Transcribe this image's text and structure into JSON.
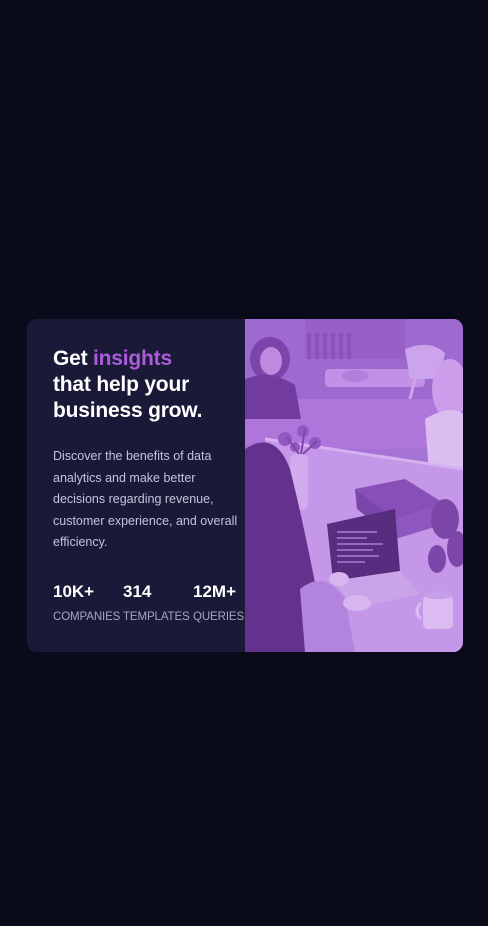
{
  "card": {
    "headline_part1": "Get ",
    "headline_accent": "insights",
    "headline_part2": "that help your business grow.",
    "description": "Discover the benefits of data analytics and make better decisions regarding revenue, customer experience, and overall efficiency.",
    "stats": [
      {
        "value": "10K+",
        "label": "COMPANIES"
      },
      {
        "value": "314",
        "label": "TEMPLATES"
      },
      {
        "value": "12M+",
        "label": "QUERIES"
      }
    ]
  },
  "colors": {
    "page_background": "#090b1a",
    "card_background": "#1b1938",
    "accent": "#ab5cdb",
    "image_overlay": "#aa5cdb"
  },
  "image": {
    "subject": "people-working-at-table-photo"
  }
}
